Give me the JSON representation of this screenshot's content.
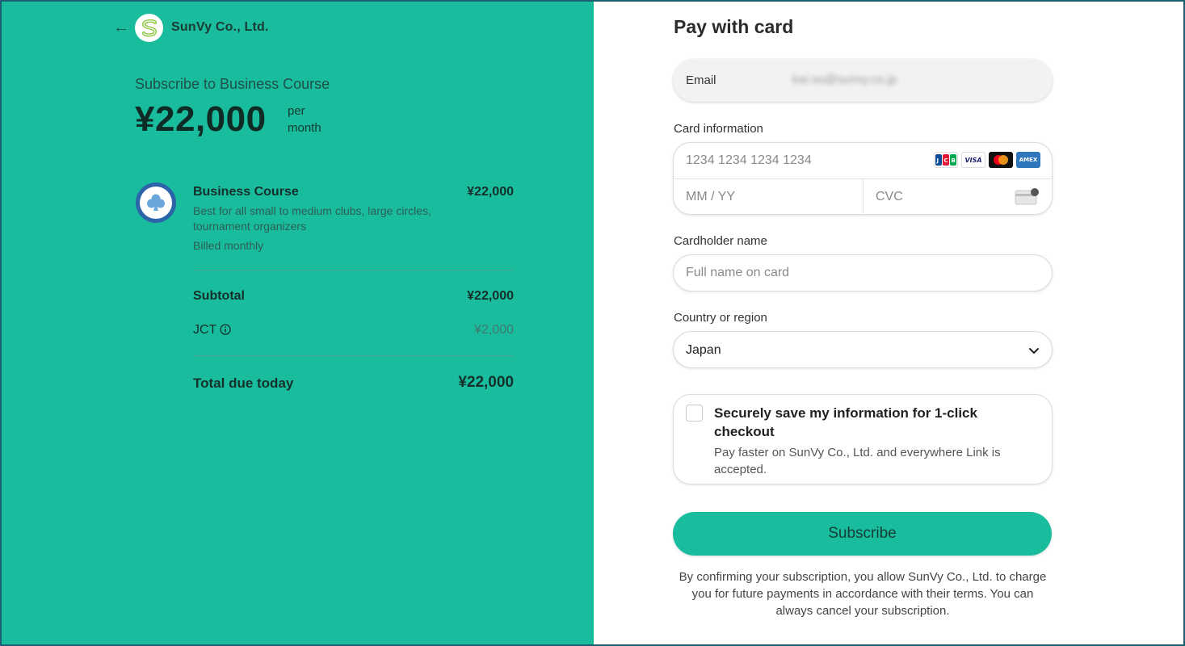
{
  "merchant": {
    "name": "SunVy Co., Ltd."
  },
  "summary": {
    "subscribe_title": "Subscribe to Business Course",
    "price": "¥22,000",
    "per_period": "per month"
  },
  "line_item": {
    "name": "Business Course",
    "price": "¥22,000",
    "description": "Best for all small to medium clubs, large circles, tournament organizers",
    "billing": "Billed monthly"
  },
  "totals": {
    "subtotal_label": "Subtotal",
    "subtotal_value": "¥22,000",
    "tax_label": "JCT",
    "tax_value": "¥2,000",
    "total_label": "Total due today",
    "total_value": "¥22,000"
  },
  "form": {
    "title": "Pay with card",
    "email_label": "Email",
    "email_value": "kai.ou@sunvy.co.jp",
    "card_label": "Card information",
    "card_number_placeholder": "1234 1234 1234 1234",
    "expiry_placeholder": "MM / YY",
    "cvc_placeholder": "CVC",
    "card_brands": [
      "JCB",
      "VISA",
      "Mastercard",
      "AMEX"
    ],
    "cardholder_label": "Cardholder name",
    "cardholder_placeholder": "Full name on card",
    "country_label": "Country or region",
    "country_value": "Japan",
    "save_title": "Securely save my information for 1-click checkout",
    "save_desc": "Pay faster on SunVy Co., Ltd. and everywhere Link is accepted.",
    "save_checked": false,
    "subscribe_label": "Subscribe",
    "legal_text": "By confirming your subscription, you allow SunVy Co., Ltd. to charge you for future payments in accordance with their terms. You can always cancel your subscription."
  },
  "colors": {
    "brand_green": "#19bc9c",
    "text_dark": "#152f2a"
  }
}
